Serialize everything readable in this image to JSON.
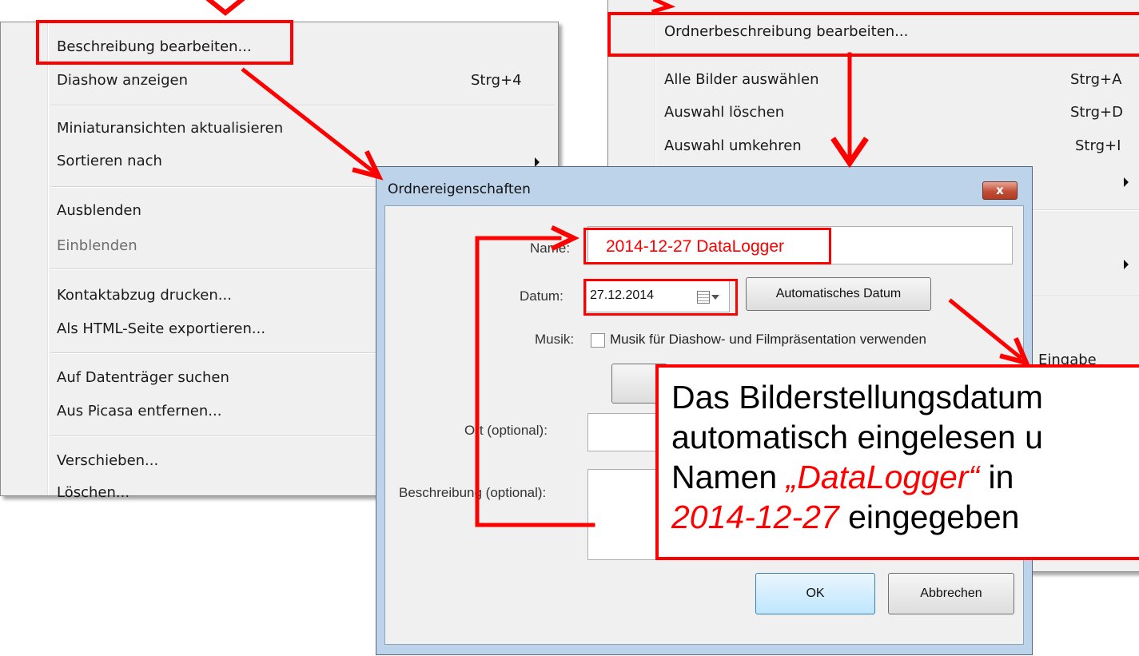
{
  "left_menu": {
    "items": [
      {
        "label": "Beschreibung bearbeiten...",
        "shortcut": "",
        "disabled": false
      },
      {
        "label": "Diashow anzeigen",
        "shortcut": "Strg+4",
        "disabled": false
      },
      {
        "label": "Miniaturansichten aktualisieren",
        "shortcut": "",
        "disabled": false
      },
      {
        "label": "Sortieren nach",
        "shortcut": "",
        "disabled": false
      },
      {
        "label": "Ausblenden",
        "shortcut": "",
        "disabled": false
      },
      {
        "label": "Einblenden",
        "shortcut": "",
        "disabled": true
      },
      {
        "label": "Kontaktabzug drucken...",
        "shortcut": "",
        "disabled": false
      },
      {
        "label": "Als HTML-Seite exportieren...",
        "shortcut": "",
        "disabled": false
      },
      {
        "label": "Auf Datenträger suchen",
        "shortcut": "",
        "disabled": false
      },
      {
        "label": "Aus Picasa entfernen...",
        "shortcut": "",
        "disabled": false
      },
      {
        "label": "Verschieben...",
        "shortcut": "",
        "disabled": false
      },
      {
        "label": "Löschen...",
        "shortcut": "",
        "disabled": false
      }
    ]
  },
  "right_menu": {
    "items": [
      {
        "label": "Ordnerbeschreibung bearbeiten...",
        "shortcut": ""
      },
      {
        "label": "Alle Bilder auswählen",
        "shortcut": "Strg+A"
      },
      {
        "label": "Auswahl löschen",
        "shortcut": "Strg+D"
      },
      {
        "label": "Auswahl umkehren",
        "shortcut": "Strg+I"
      },
      {
        "label": "Eingabe",
        "shortcut": ""
      }
    ]
  },
  "dialog": {
    "title": "Ordnereigenschaften",
    "close_glyph": "x",
    "name_label": "Name:",
    "name_value": "2014-12-27 DataLogger",
    "date_label": "Datum:",
    "date_value": "27.12.2014",
    "auto_date_button": "Automatisches Datum",
    "music_label": "Musik:",
    "music_checkbox_label": "Musik für Diashow- und Filmpräsentation verwenden",
    "place_label": "Ort (optional):",
    "description_label": "Beschreibung (optional):",
    "ok_button": "OK",
    "cancel_button": "Abbrechen"
  },
  "annotation": {
    "line1": "Das Bilderstellungsdatum",
    "line2": "automatisch eingelesen u",
    "line3_pre": "Namen ",
    "line3_em": "„DataLogger“",
    "line3_post": " in",
    "line4_em": "2014-12-27",
    "line4_post": " eingegeben",
    "color": "#ff0000"
  }
}
